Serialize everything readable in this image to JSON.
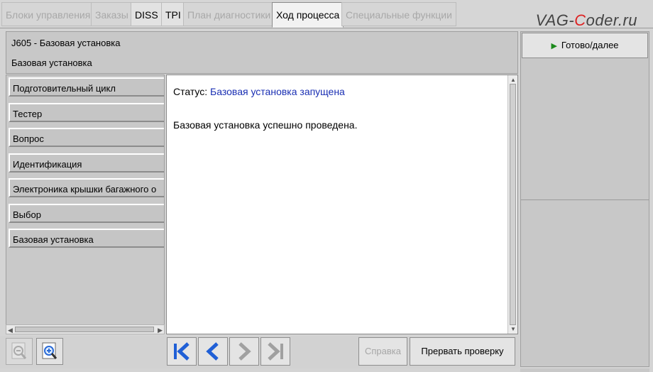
{
  "tabs": [
    {
      "label": "Блоки управления",
      "state": "disabled"
    },
    {
      "label": "Заказы",
      "state": "disabled"
    },
    {
      "label": "DISS",
      "state": "enabled"
    },
    {
      "label": "TPI",
      "state": "enabled"
    },
    {
      "label": "План диагностики",
      "state": "disabled"
    },
    {
      "label": "Ход процесса",
      "state": "active"
    },
    {
      "label": "Специальные функции",
      "state": "disabled"
    }
  ],
  "watermark": {
    "prefix": "VAG-",
    "highlight": "C",
    "suffix": "oder.ru"
  },
  "header": {
    "title": "J605 - Базовая установка",
    "subtitle": "Базовая установка"
  },
  "steps": [
    "Подготовительный цикл",
    "Тестер",
    "Вопрос",
    "Идентификация",
    "Электроника крышки багажного о",
    "Выбор",
    "Базовая установка"
  ],
  "content": {
    "status_label": "Статус:",
    "status_value": "Базовая установка запущена",
    "message": "Базовая установка успешно проведена."
  },
  "right_panel": {
    "ready_label": "Готово/далее"
  },
  "toolbar": {
    "help_label": "Справка",
    "abort_label": "Прервать проверку"
  },
  "colors": {
    "status_value": "#1a2fb3",
    "nav_arrow": "#1f5fd6",
    "nav_arrow_disabled": "#a0a0a0",
    "ready_triangle": "#1b8a1b",
    "watermark_accent": "#dd2222"
  },
  "icons": {
    "zoom_out": "zoom-out-icon",
    "zoom_in": "zoom-in-icon",
    "first": "first-icon",
    "back": "back-icon",
    "forward": "forward-icon",
    "last": "last-icon",
    "ready": "play-triangle-icon"
  }
}
